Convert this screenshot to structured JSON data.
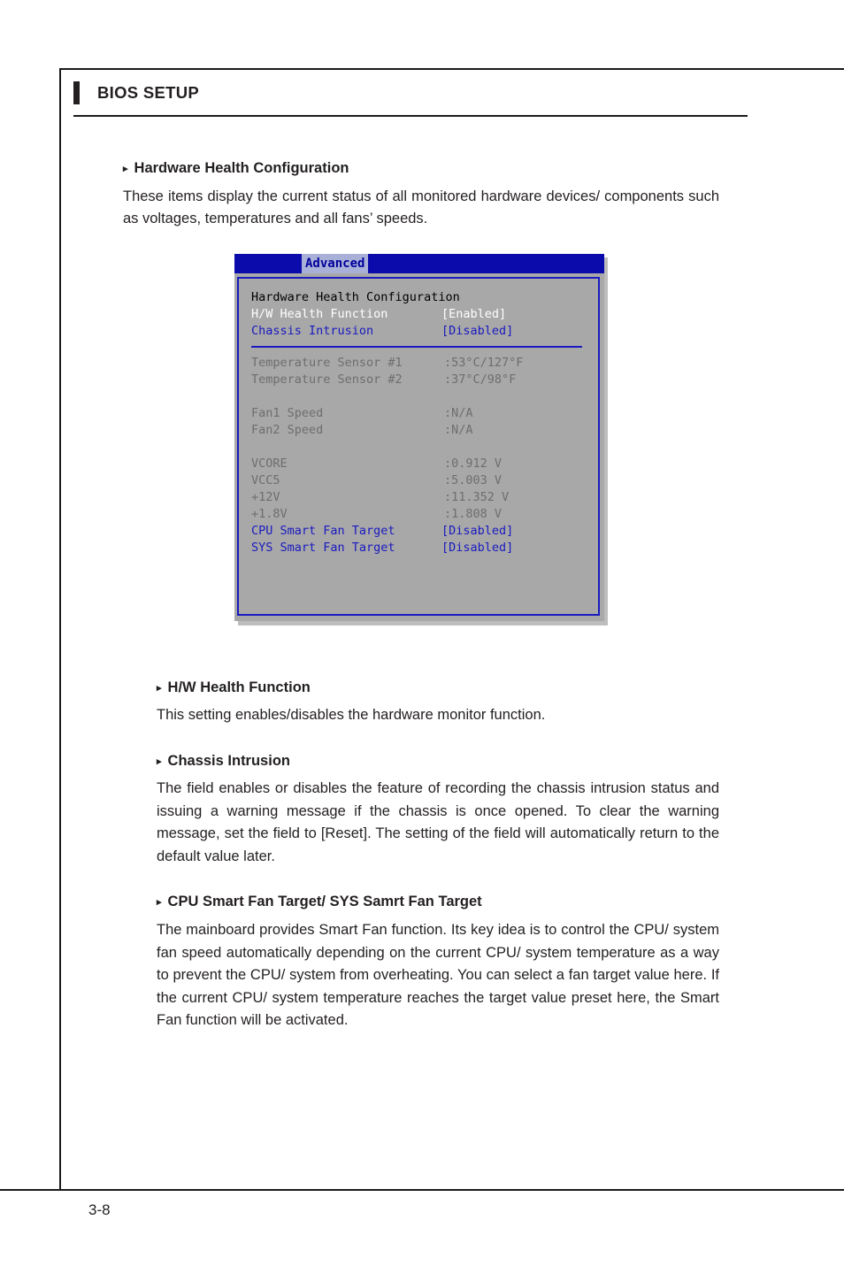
{
  "header": {
    "title": "BIOS SETUP"
  },
  "footer": {
    "page_number": "3-8"
  },
  "sections": [
    {
      "heading": "Hardware Health Configuration",
      "arrow": "▸",
      "body": "These items display the current status of all monitored hardware devices/ components such as voltages, temperatures and all fans’ speeds."
    },
    {
      "heading": "H/W Health Function",
      "arrow": "▸",
      "body": "This setting enables/disables the hardware monitor function."
    },
    {
      "heading": "Chassis Intrusion",
      "arrow": "▸",
      "body": "The field enables or disables the feature of recording the chassis intrusion status and issuing a warning message if the chassis is once opened. To clear the warning message, set the field to [Reset]. The setting of the field will automatically return to the default value later."
    },
    {
      "heading": "CPU Smart Fan Target/ SYS Samrt Fan Target",
      "arrow": "▸",
      "body": "The mainboard provides Smart Fan function. Its key idea is to control the CPU/ system fan speed automatically depending on the current CPU/ system temperature as a way to prevent the CPU/ system from overheating. You can select a fan target value here. If the current CPU/ system temperature reaches the target value preset here, the Smart Fan function will be activated."
    }
  ],
  "bios_screen": {
    "active_tab": "Advanced",
    "panel_title": "Hardware Health Configuration",
    "colors": {
      "titlebar": "#0b0bab",
      "tab_highlight": "#a8b0d8",
      "panel_background": "#a8a8a8",
      "border": "#1a1ac0",
      "selected_text": "#1a1ac0",
      "normal_text": "#ffffff",
      "readonly_text": "#6e6e6e",
      "title_text": "#000000"
    },
    "settings": [
      {
        "label": "H/W Health Function",
        "value": "[Enabled]",
        "style": "normal"
      },
      {
        "label": "Chassis Intrusion",
        "value": "[Disabled]",
        "style": "selected"
      }
    ],
    "monitors_temperature": [
      {
        "label": "Temperature Sensor #1",
        "value": ":53°C/127°F"
      },
      {
        "label": "Temperature Sensor #2",
        "value": ":37°C/98°F"
      }
    ],
    "monitors_fan": [
      {
        "label": "Fan1 Speed",
        "value": ":N/A"
      },
      {
        "label": "Fan2 Speed",
        "value": ":N/A"
      }
    ],
    "monitors_voltage": [
      {
        "label": "VCORE",
        "value": ":0.912 V"
      },
      {
        "label": "VCC5",
        "value": ":5.003 V"
      },
      {
        "label": "+12V",
        "value": ":11.352 V"
      },
      {
        "label": "+1.8V",
        "value": ":1.808 V"
      }
    ],
    "fan_targets": [
      {
        "label": "CPU Smart Fan Target",
        "value": "[Disabled]",
        "style": "selected"
      },
      {
        "label": "SYS Smart Fan Target",
        "value": "[Disabled]",
        "style": "selected"
      }
    ]
  }
}
